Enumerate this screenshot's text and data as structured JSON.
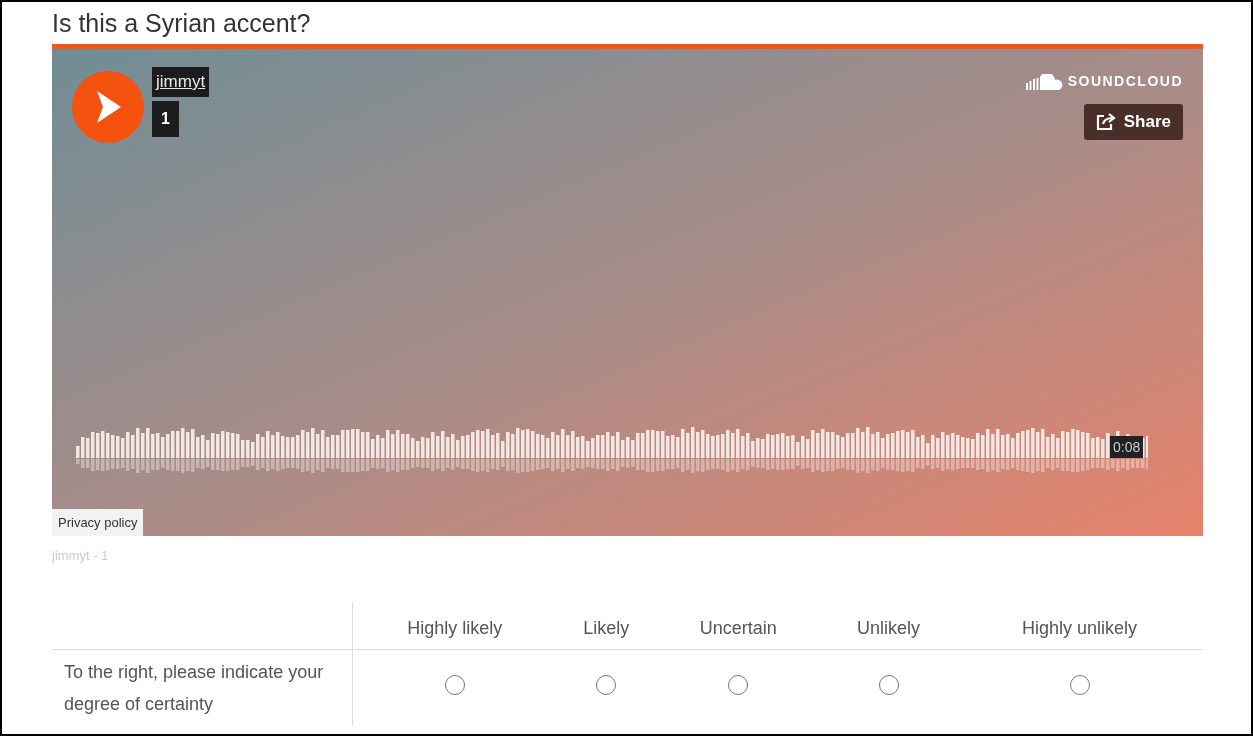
{
  "question": {
    "title": "Is this a Syrian accent?"
  },
  "player": {
    "user": "jimmyt",
    "track": "1",
    "brand": "SOUNDCLOUD",
    "share": "Share",
    "duration": "0:08",
    "privacy": "Privacy policy"
  },
  "caption": "jimmyt - 1",
  "scale": {
    "columns": [
      "Highly likely",
      "Likely",
      "Uncertain",
      "Unlikely",
      "Highly unlikely"
    ],
    "rows": [
      {
        "label": "To the right, please indicate your degree of certainty",
        "options": [
          {
            "selected": false
          },
          {
            "selected": false
          },
          {
            "selected": false
          },
          {
            "selected": false
          },
          {
            "selected": false
          }
        ]
      }
    ]
  }
}
